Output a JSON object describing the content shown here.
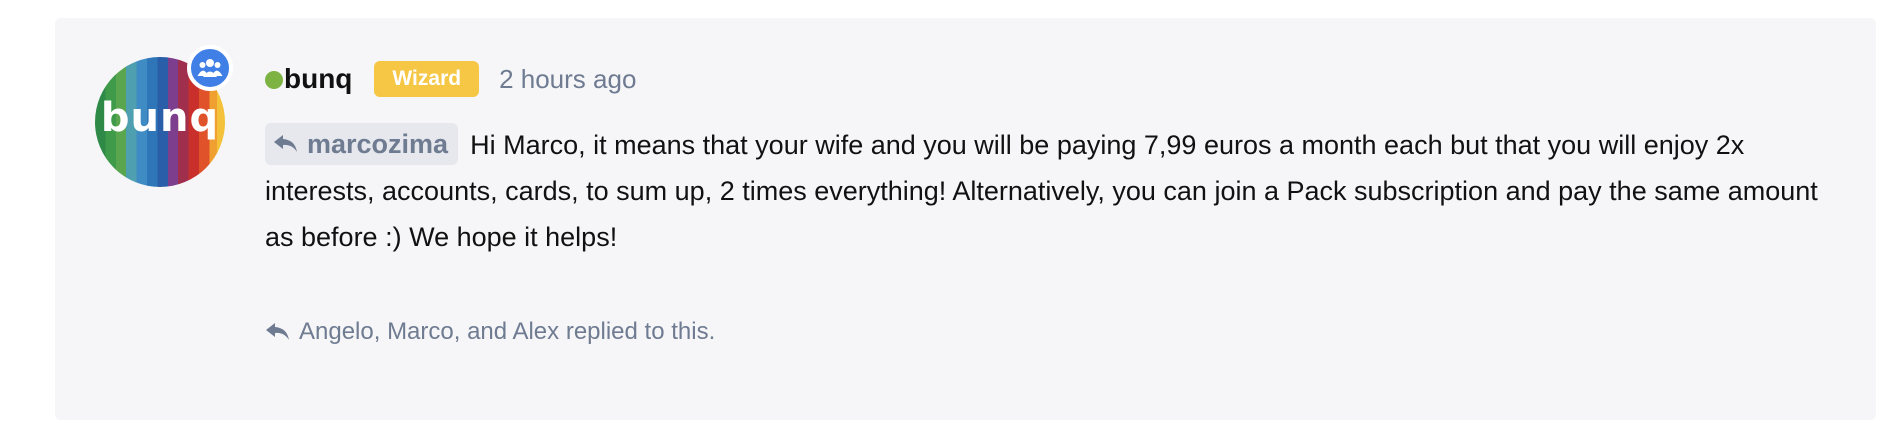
{
  "post": {
    "author": {
      "avatar_text": "bunq",
      "username": "bunq",
      "rank": "Wizard",
      "online": true,
      "rank_color": "#f6c744",
      "online_color": "#7cb342",
      "group_badge_color": "#3f7fe6"
    },
    "timestamp": "2 hours ago",
    "reply_to": {
      "icon": "reply-arrow-icon",
      "username": "marcozima"
    },
    "body": "Hi Marco, it means that your wife and you will be paying 7,99 euros a month each but that you will enjoy 2x interests, accounts, cards, to sum up, 2 times everything! Alternatively, you can join a Pack subscription and pay the same amount as before :) We hope it helps!",
    "replies_summary": "Angelo, Marco, and Alex replied to this."
  }
}
